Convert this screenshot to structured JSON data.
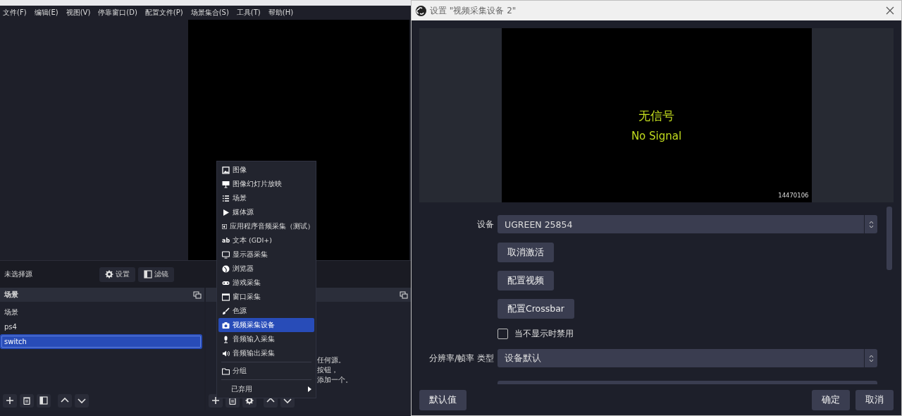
{
  "main_window": {
    "menu_bar": [
      "文件(F)",
      "编辑(E)",
      "视图(V)",
      "停靠窗口(D)",
      "配置文件(P)",
      "场景集合(S)",
      "工具(T)",
      "帮助(H)"
    ],
    "source_toolbar": {
      "label": "未选择源",
      "buttons": [
        "设置",
        "滤镜"
      ]
    },
    "scenes_dock": {
      "title": "场景",
      "items": [
        {
          "label": "场景",
          "selected": false
        },
        {
          "label": "ps4",
          "selected": false
        },
        {
          "label": "switch",
          "selected": true
        }
      ]
    },
    "sources_dock": {
      "hint_lines": [
        "任何源。",
        "按钮，",
        "添加一个。"
      ]
    },
    "context_menu": {
      "items": [
        {
          "kind": "item",
          "label": "图像",
          "selected": false
        },
        {
          "kind": "item",
          "label": "图像幻灯片放映",
          "selected": false
        },
        {
          "kind": "item",
          "label": "场景",
          "selected": false
        },
        {
          "kind": "item",
          "label": "媒体源",
          "selected": false
        },
        {
          "kind": "item",
          "label": "应用程序音频采集（测试）",
          "selected": false
        },
        {
          "kind": "item",
          "label": "文本 (GDI+)",
          "selected": false,
          "glyph": "ab"
        },
        {
          "kind": "item",
          "label": "显示器采集",
          "selected": false
        },
        {
          "kind": "item",
          "label": "浏览器",
          "selected": false
        },
        {
          "kind": "item",
          "label": "游戏采集",
          "selected": false
        },
        {
          "kind": "item",
          "label": "窗口采集",
          "selected": false
        },
        {
          "kind": "item",
          "label": "色源",
          "selected": false
        },
        {
          "kind": "item",
          "label": "视频采集设备",
          "selected": true
        },
        {
          "kind": "item",
          "label": "音频输入采集",
          "selected": false
        },
        {
          "kind": "item",
          "label": "音频输出采集",
          "selected": false
        },
        {
          "kind": "separator"
        },
        {
          "kind": "item",
          "label": "分组",
          "selected": false
        },
        {
          "kind": "separator"
        },
        {
          "kind": "submenu",
          "label": "已弃用",
          "selected": false
        }
      ]
    }
  },
  "dialog": {
    "title": "设置 \"视频采集设备 2\"",
    "preview": {
      "line_1": "无信号",
      "line_2": "No Signal",
      "code": "14470106"
    },
    "form": [
      {
        "kind": "select",
        "label": "设备",
        "value": "UGREEN 25854"
      },
      {
        "kind": "button",
        "label": "取消激活"
      },
      {
        "kind": "button",
        "label": "配置视频"
      },
      {
        "kind": "button",
        "label": "配置Crossbar"
      },
      {
        "kind": "checkbox",
        "label": "当不显示时禁用",
        "checked": false
      },
      {
        "kind": "select",
        "label": "分辨率/帧率 类型",
        "value": "设备默认"
      },
      {
        "kind": "cut"
      }
    ],
    "footer_left": "默认值",
    "footer_right": [
      "确定",
      "取消"
    ]
  }
}
